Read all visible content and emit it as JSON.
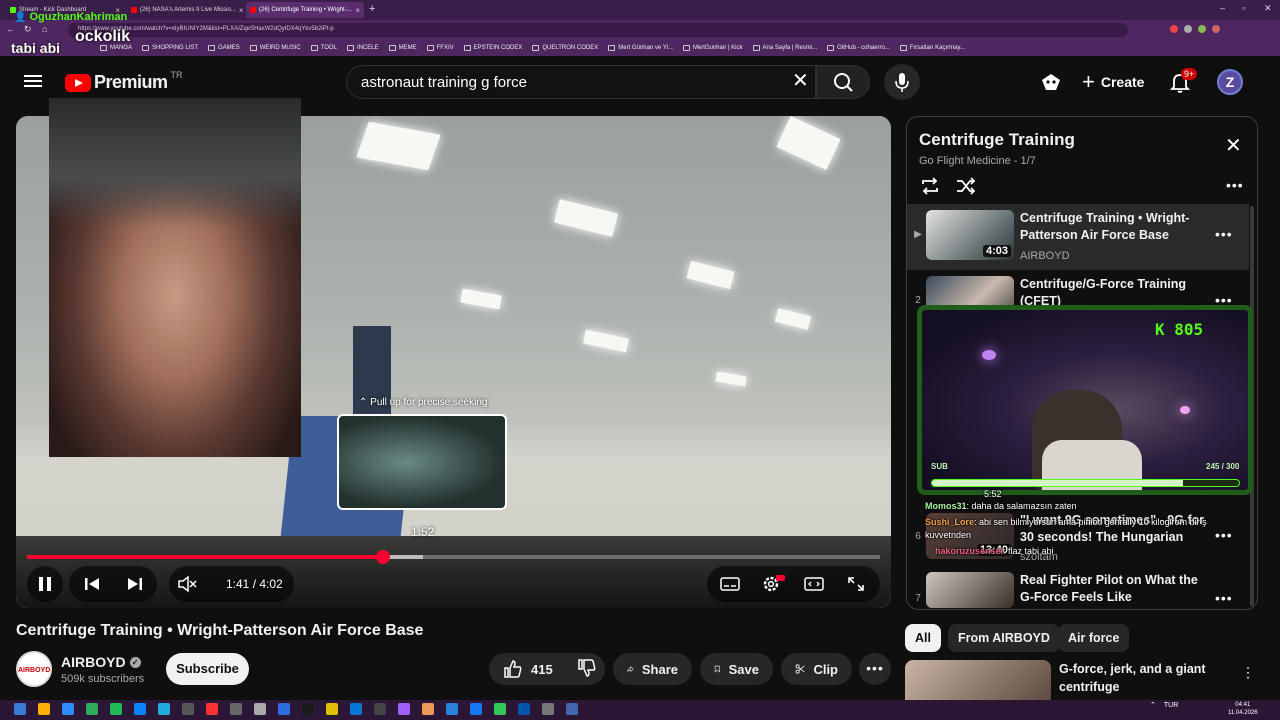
{
  "browser": {
    "tabs": [
      {
        "label": "Stream - Kick Dashboard",
        "active": false
      },
      {
        "label": "(26) NASA's Artemis II Live Missio...",
        "active": false
      },
      {
        "label": "(26) Centrifuge Training • Wright-...",
        "active": true
      }
    ],
    "url": "https://www.youtube.com/watch?v=xIyBIUNIY2M&list=PLXAIZqeSHaxW2dQyIDX4qYkv5b2iPt-p",
    "bookmarks": [
      "MANGA",
      "SHOPPING LIST",
      "GAMES",
      "WEIRD MUSIC",
      "TOOL",
      "INCELE",
      "MEME",
      "FFXIV",
      "EPSTEIN CODEX",
      "QUELTRON CODEX",
      "Mert Günhan ve Yi...",
      "MertGunhan | Kick",
      "Ana Sayfa | Resmi...",
      "GitHub - cohaerro...",
      "Fırsatları Kaçırmay..."
    ]
  },
  "overlay": {
    "streamer_name": "OguzhanKahriman",
    "caption": "tabi abi",
    "brand": "ockolik",
    "kb_label": "K 805",
    "sub_label": "SUB",
    "sub_count": "245 / 300",
    "sub_progress": 0.8167,
    "chat": [
      {
        "user": "",
        "text": "5:52"
      },
      {
        "user": "Momos31",
        "text": ": daha da salamazsın zaten"
      },
      {
        "user": "Sushi_Lore",
        "text": ": abi sen bilmiyorsun ama piriloti genrally 10 kilogirom bir ş"
      },
      {
        "user": "",
        "text": "kuvvetnden"
      },
      {
        "user": "hakoruzusensei",
        "text": ": flaz tabi abi"
      }
    ]
  },
  "youtube": {
    "logo_word": "Premium",
    "logo_region": "TR",
    "search_value": "astronaut training g force",
    "create_label": "Create",
    "notif_badge": "9+",
    "avatar_letter": "Z"
  },
  "player": {
    "seek_hint": "Pull up for precise seeking",
    "preview_time": "1:52",
    "time_display": "1:41 / 4:02",
    "progress": 0.4174,
    "buffered": 0.464
  },
  "video": {
    "title": "Centrifuge Training • Wright-Patterson Air Force Base",
    "channel": "AIRBOYD",
    "channel_avatar_text": "AIRBOYD",
    "subscribers": "509k subscribers",
    "subscribe_label": "Subscribe",
    "likes": "415",
    "share_label": "Share",
    "save_label": "Save",
    "clip_label": "Clip"
  },
  "playlist": {
    "title": "Centrifuge Training",
    "subtitle": "Go Flight Medicine - 1/7",
    "items": [
      {
        "num": "▶",
        "title": "Centrifuge Training • Wright-Patterson Air Force Base",
        "channel": "AIRBOYD",
        "duration": "4:03"
      },
      {
        "num": "2",
        "title": "Centrifuge/G-Force Training (CFET)",
        "channel": "",
        "duration": ""
      },
      {
        "num": "6",
        "title": "\"I want 9G sometimes\" - 9G for 30 seconds! The Hungarian G-...",
        "channel": "szoltam",
        "duration": "13:40"
      },
      {
        "num": "7",
        "title": "Real Fighter Pilot on What the G-Force Feels Like",
        "channel": "",
        "duration": ""
      }
    ]
  },
  "chips": [
    "All",
    "From AIRBOYD",
    "Air force"
  ],
  "recommendation": {
    "title": "G-force, jerk, and a giant centrifuge"
  },
  "taskbar": {
    "lang": "TUR",
    "time": "04:41",
    "date": "11.04.2026"
  }
}
